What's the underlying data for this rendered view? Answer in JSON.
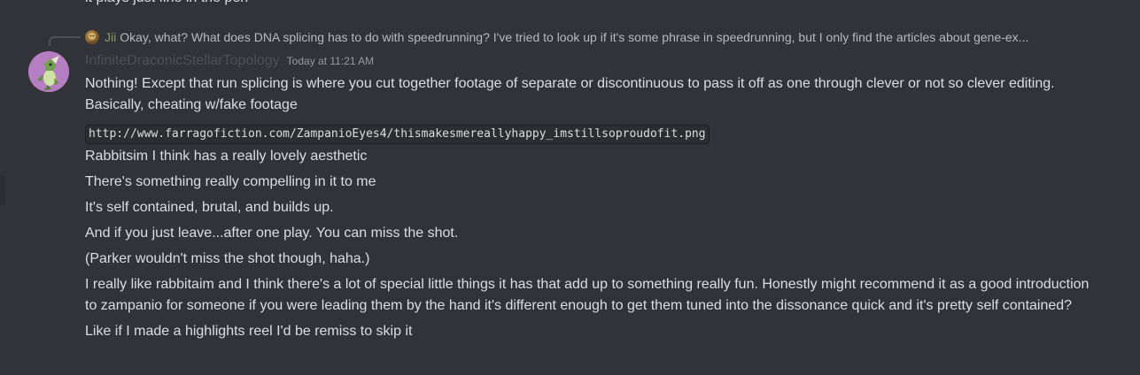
{
  "previous_message": {
    "text": "it plays just fine in the pen"
  },
  "reply": {
    "author": "Jii",
    "avatar_icon": "user-avatar-icon",
    "text": "Okay, what? What does DNA splicing has to do with speedrunning? I've tried to look up if it's some phrase in speedrunning, but I only find the articles about gene-ex..."
  },
  "message": {
    "username": "InfiniteDraconicStellarTopology",
    "timestamp": "Today at 11:21 AM",
    "avatar_icon": "dragon-avatar-icon",
    "lines": [
      "Nothing! Except that run splicing is where you cut together footage of separate or discontinuous to pass it off as one through clever or not so clever editing. Basically, cheating w/fake footage",
      "http://www.farragofiction.com/ZampanioEyes4/thismakesmereallyhappy_imstillsoproudofit.png",
      "Rabbitsim I think has a really lovely aesthetic",
      "There's something really compelling in it to me",
      "It's self contained, brutal, and builds up.",
      "And if you just leave...after one play. You can miss the shot.",
      "(Parker wouldn't miss the shot though, haha.)",
      "I really like rabbitaim and I think there's a lot of special little things it has that add up to something really fun. Honestly might recommend it as a good introduction to zampanio for someone if you were leading them by the hand it's different enough to get them tuned into the dissonance quick and it's pretty self contained?",
      "Like if I made a highlights reel I'd be remiss to skip it"
    ]
  },
  "colors": {
    "background": "#313338",
    "username": "#4e5058",
    "reply_author": "#8f9a6a",
    "avatar_bg": "#b57ec0"
  }
}
